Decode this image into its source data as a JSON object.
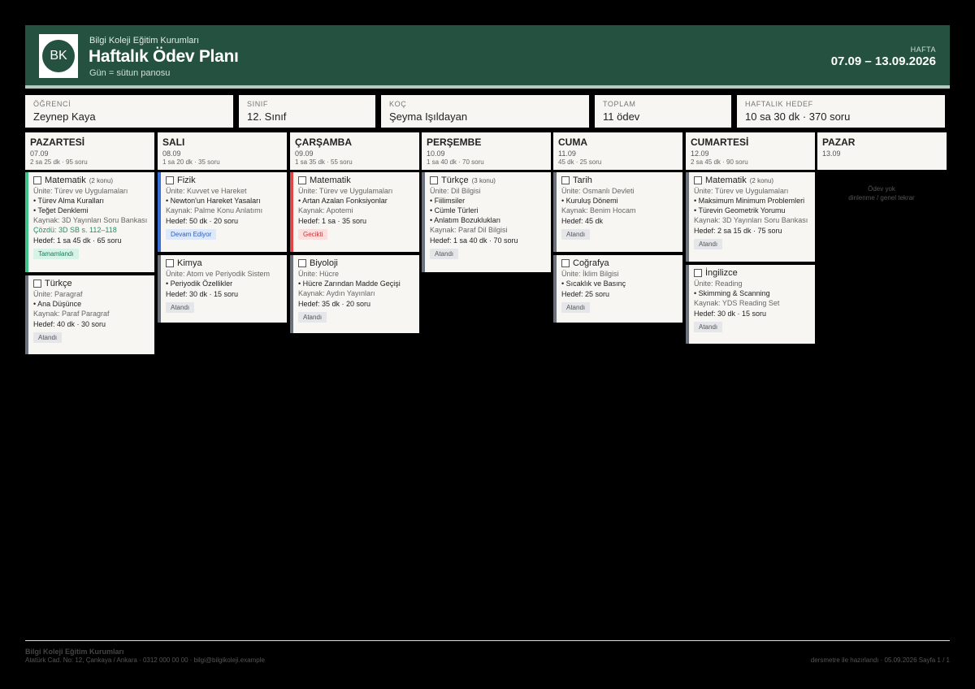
{
  "header": {
    "logo_text": "BK",
    "school": "Bilgi Koleji Eğitim Kurumları",
    "title": "Haftalık Ödev Planı",
    "subtitle": "Gün = sütun panosu",
    "week_label": "HAFTA",
    "week_range": "07.09 – 13.09.2026"
  },
  "info": {
    "student_label": "ÖĞRENCİ",
    "student": "Zeynep Kaya",
    "class_label": "SINIF",
    "class": "12. Sınıf",
    "coach_label": "KOÇ",
    "coach": "Şeyma Işıldayan",
    "total_label": "TOPLAM",
    "total": "11 ödev",
    "goal_label": "HAFTALIK HEDEF",
    "goal": "10 sa 30 dk · 370 soru"
  },
  "days": [
    {
      "name": "PAZARTESİ",
      "date": "07.09",
      "summary": "2 sa 25 dk · 95 soru"
    },
    {
      "name": "SALI",
      "date": "08.09",
      "summary": "1 sa 20 dk · 35 soru"
    },
    {
      "name": "ÇARŞAMBA",
      "date": "09.09",
      "summary": "1 sa 35 dk · 55 soru"
    },
    {
      "name": "PERŞEMBE",
      "date": "10.09",
      "summary": "1 sa 40 dk · 70 soru"
    },
    {
      "name": "CUMA",
      "date": "11.09",
      "summary": "45 dk · 25 soru"
    },
    {
      "name": "CUMARTESİ",
      "date": "12.09",
      "summary": "2 sa 45 dk · 90 soru"
    },
    {
      "name": "PAZAR",
      "date": "13.09",
      "summary": ""
    }
  ],
  "cards": {
    "mon_math": {
      "title": "Matematik",
      "konu": "(2 konu)",
      "unit": "Ünite: Türev ve Uygulamaları",
      "b1": "• Türev Alma Kuralları",
      "b2": "• Teğet Denklemi",
      "source": "Kaynak: 3D Yayınları Soru Bankası",
      "done": "Çözdü: 3D SB s. 112–118",
      "target": "Hedef: 1 sa 45 dk · 65 soru",
      "status": "Tamamlandı"
    },
    "mon_turk": {
      "title": "Türkçe",
      "unit": "Ünite: Paragraf",
      "b1": "• Ana Düşünce",
      "source": "Kaynak: Paraf Paragraf",
      "target": "Hedef: 40 dk · 30 soru",
      "status": "Atandı"
    },
    "tue_phys": {
      "title": "Fizik",
      "unit": "Ünite: Kuvvet ve Hareket",
      "b1": "• Newton'un Hareket Yasaları",
      "source": "Kaynak: Palme Konu Anlatımı",
      "target": "Hedef: 50 dk · 20 soru",
      "status": "Devam Ediyor"
    },
    "tue_chem": {
      "title": "Kimya",
      "unit": "Ünite: Atom ve Periyodik Sistem",
      "b1": "• Periyodik Özellikler",
      "target": "Hedef: 30 dk · 15 soru",
      "status": "Atandı"
    },
    "wed_math": {
      "title": "Matematik",
      "unit": "Ünite: Türev ve Uygulamaları",
      "b1": "• Artan Azalan Fonksiyonlar",
      "source": "Kaynak: Apotemi",
      "target": "Hedef: 1 sa · 35 soru",
      "status": "Gecikti"
    },
    "wed_bio": {
      "title": "Biyoloji",
      "unit": "Ünite: Hücre",
      "b1": "• Hücre Zarından Madde Geçişi",
      "source": "Kaynak: Aydın Yayınları",
      "target": "Hedef: 35 dk · 20 soru",
      "status": "Atandı"
    },
    "thu_turk": {
      "title": "Türkçe",
      "konu": "(3 konu)",
      "unit": "Ünite: Dil Bilgisi",
      "b1": "• Fiilimsiler",
      "b2": "• Cümle Türleri",
      "b3": "• Anlatım Bozuklukları",
      "source": "Kaynak: Paraf Dil Bilgisi",
      "target": "Hedef: 1 sa 40 dk · 70 soru",
      "status": "Atandı"
    },
    "fri_hist": {
      "title": "Tarih",
      "unit": "Ünite: Osmanlı Devleti",
      "b1": "• Kuruluş Dönemi",
      "source": "Kaynak: Benim Hocam",
      "target": "Hedef: 45 dk",
      "status": "Atandı"
    },
    "fri_geo": {
      "title": "Coğrafya",
      "unit": "Ünite: İklim Bilgisi",
      "b1": "• Sıcaklık ve Basınç",
      "target": "Hedef: 25 soru",
      "status": "Atandı"
    },
    "sat_math": {
      "title": "Matematik",
      "konu": "(2 konu)",
      "unit": "Ünite: Türev ve Uygulamaları",
      "b1": "• Maksimum Minimum Problemleri",
      "b2": "• Türevin Geometrik Yorumu",
      "source": "Kaynak: 3D Yayınları Soru Bankası",
      "target": "Hedef: 2 sa 15 dk · 75 soru",
      "status": "Atandı"
    },
    "sat_eng": {
      "title": "İngilizce",
      "unit": "Ünite: Reading",
      "b1": "• Skimming & Scanning",
      "source": "Kaynak: YDS Reading Set",
      "target": "Hedef: 30 dk · 15 soru",
      "status": "Atandı"
    }
  },
  "sunday_note_1": "Ödev yok",
  "sunday_note_2": "dinlenme / genel tekrar",
  "colors": {
    "header_green": "#255240",
    "math": "#3cc48a",
    "physics": "#3a72d8",
    "late_red": "#e04848",
    "neutral": "#6c727b"
  },
  "footer": {
    "school": "Bilgi Koleji Eğitim Kurumları",
    "address": "Atatürk Cad. No: 12, Çankaya / Ankara · 0312 000 00 00 · bilgi@bilgikoleji.example",
    "right": "dersmetre ile hazırlandı · 05.09.2026   Sayfa 1 / 1"
  }
}
